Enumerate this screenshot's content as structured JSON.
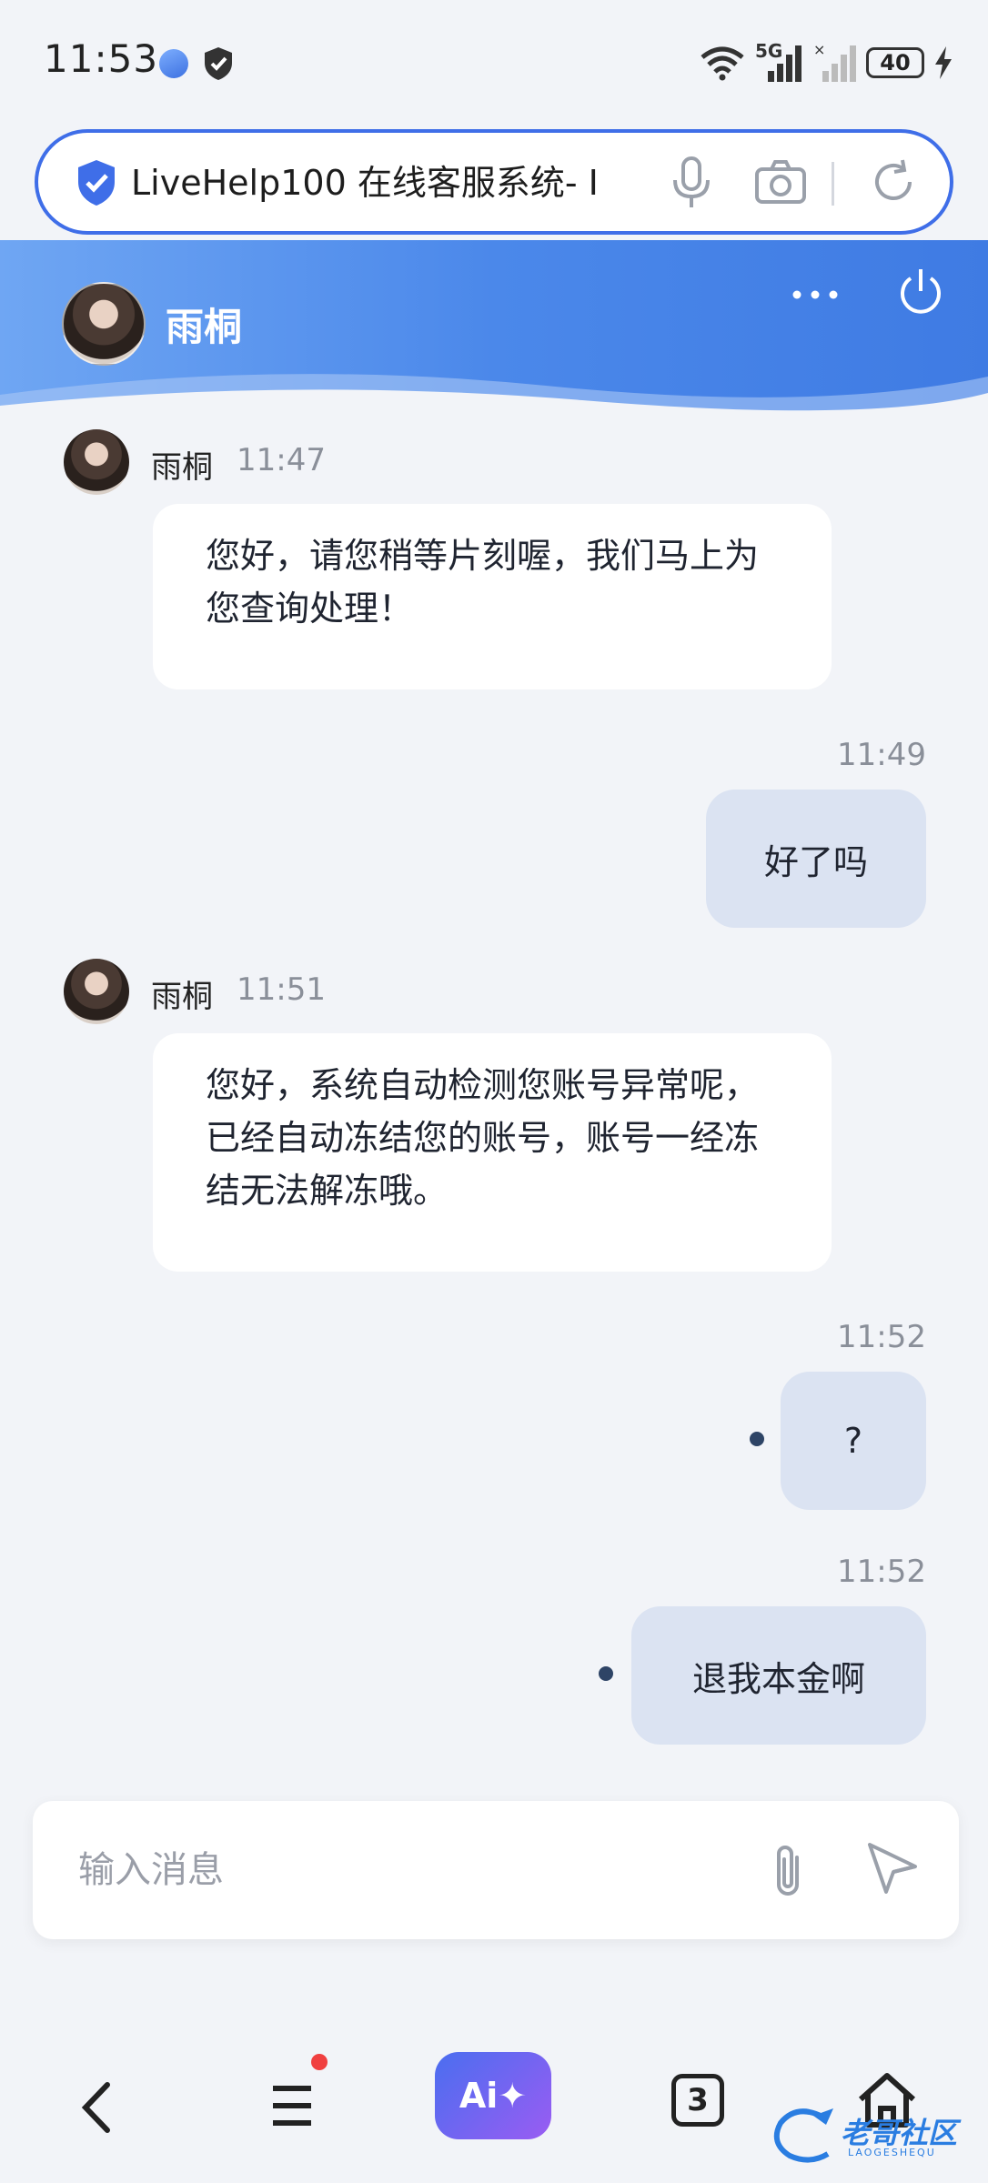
{
  "status_bar": {
    "time": "11:53",
    "network": "5G",
    "battery": "40"
  },
  "url_bar": {
    "title": "LiveHelp100 在线客服系统- I"
  },
  "chat_header": {
    "agent_name": "雨桐"
  },
  "messages": [
    {
      "direction": "in",
      "sender": "雨桐",
      "time": "11:47",
      "text": "您好，请您稍等片刻喔，我们马上为您查询处理！"
    },
    {
      "direction": "out",
      "time": "11:49",
      "text": "好了吗"
    },
    {
      "direction": "in",
      "sender": "雨桐",
      "time": "11:51",
      "text": "您好，系统自动检测您账号异常呢，已经自动冻结您的账号，账号一经冻结无法解冻哦。"
    },
    {
      "direction": "out",
      "time": "11:52",
      "text": "?"
    },
    {
      "direction": "out",
      "time": "11:52",
      "text": "退我本金啊"
    }
  ],
  "composer": {
    "placeholder": "输入消息",
    "value": ""
  },
  "bottom_nav": {
    "ai_label": "Ai✦",
    "tab_count": "3"
  },
  "watermark": {
    "text": "老哥社区",
    "sub": "LAOGESHEQU"
  },
  "colors": {
    "accent": "#3f6ee8",
    "header_gradient_start": "#6fa6f3",
    "header_gradient_end": "#3f7be3",
    "outgoing_bubble": "#dbe3f2",
    "incoming_bubble": "#ffffff",
    "background": "#f2f4f8"
  }
}
